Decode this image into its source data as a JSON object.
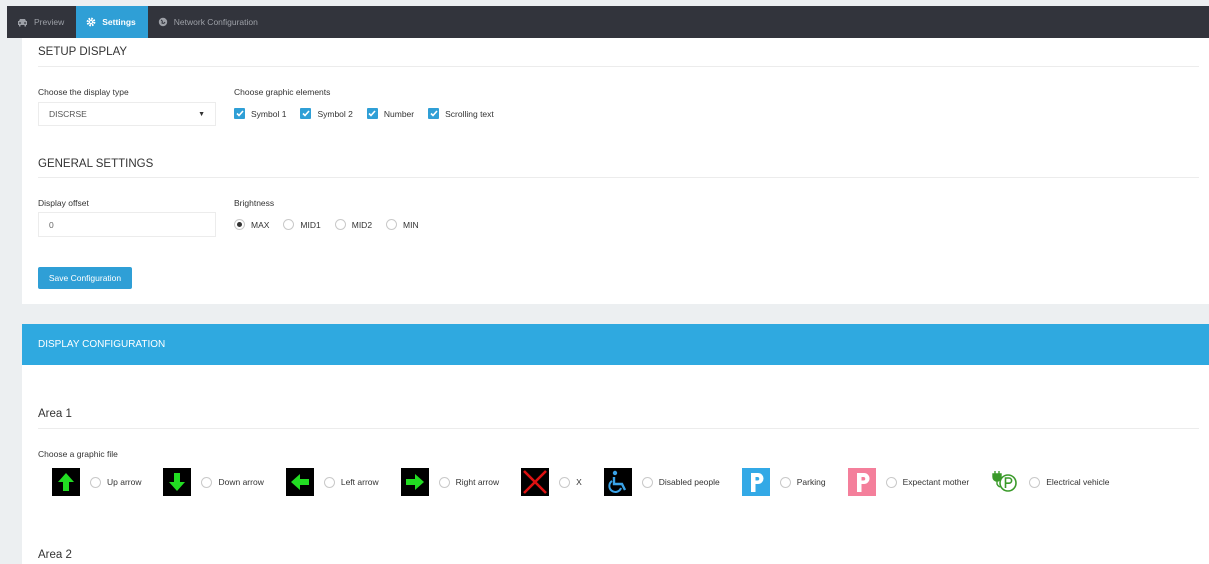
{
  "nav": {
    "tabs": [
      {
        "label": "Preview",
        "icon": "car-icon",
        "active": false
      },
      {
        "label": "Settings",
        "icon": "gear-icon",
        "active": true
      },
      {
        "label": "Network Configuration",
        "icon": "globe-icon",
        "active": false
      }
    ]
  },
  "setup": {
    "title": "SETUP DISPLAY",
    "display_type_label": "Choose the display type",
    "display_type_value": "DISCRSE",
    "graphic_elements_label": "Choose graphic elements",
    "graphic_elements": [
      {
        "label": "Symbol 1",
        "checked": true
      },
      {
        "label": "Symbol 2",
        "checked": true
      },
      {
        "label": "Number",
        "checked": true
      },
      {
        "label": "Scrolling text",
        "checked": true
      }
    ]
  },
  "general": {
    "title": "GENERAL SETTINGS",
    "offset_label": "Display offset",
    "offset_value": "0",
    "brightness_label": "Brightness",
    "brightness_options": [
      {
        "label": "MAX",
        "selected": true
      },
      {
        "label": "MID1",
        "selected": false
      },
      {
        "label": "MID2",
        "selected": false
      },
      {
        "label": "MIN",
        "selected": false
      }
    ],
    "save_label": "Save Configuration"
  },
  "display_config": {
    "header": "DISPLAY CONFIGURATION",
    "area1_title": "Area 1",
    "graphic_file_label": "Choose a graphic file",
    "graphics": [
      {
        "label": "Up arrow",
        "icon": "up-arrow-icon"
      },
      {
        "label": "Down arrow",
        "icon": "down-arrow-icon"
      },
      {
        "label": "Left arrow",
        "icon": "left-arrow-icon"
      },
      {
        "label": "Right arrow",
        "icon": "right-arrow-icon"
      },
      {
        "label": "X",
        "icon": "x-icon"
      },
      {
        "label": "Disabled people",
        "icon": "wheelchair-icon"
      },
      {
        "label": "Parking",
        "icon": "parking-icon"
      },
      {
        "label": "Expectant mother",
        "icon": "parking-pink-icon"
      },
      {
        "label": "Electrical vehicle",
        "icon": "ev-charging-icon"
      }
    ],
    "area2_title": "Area 2"
  },
  "colors": {
    "nav_bg": "#32343c",
    "accent": "#2f9fd6",
    "header_blue": "#2fa9e0",
    "arrow_green": "#22dd22",
    "x_red": "#dd1111",
    "parking_blue": "#33a9e6",
    "parking_pink": "#f47f9b",
    "ev_green": "#3a9a2a"
  }
}
